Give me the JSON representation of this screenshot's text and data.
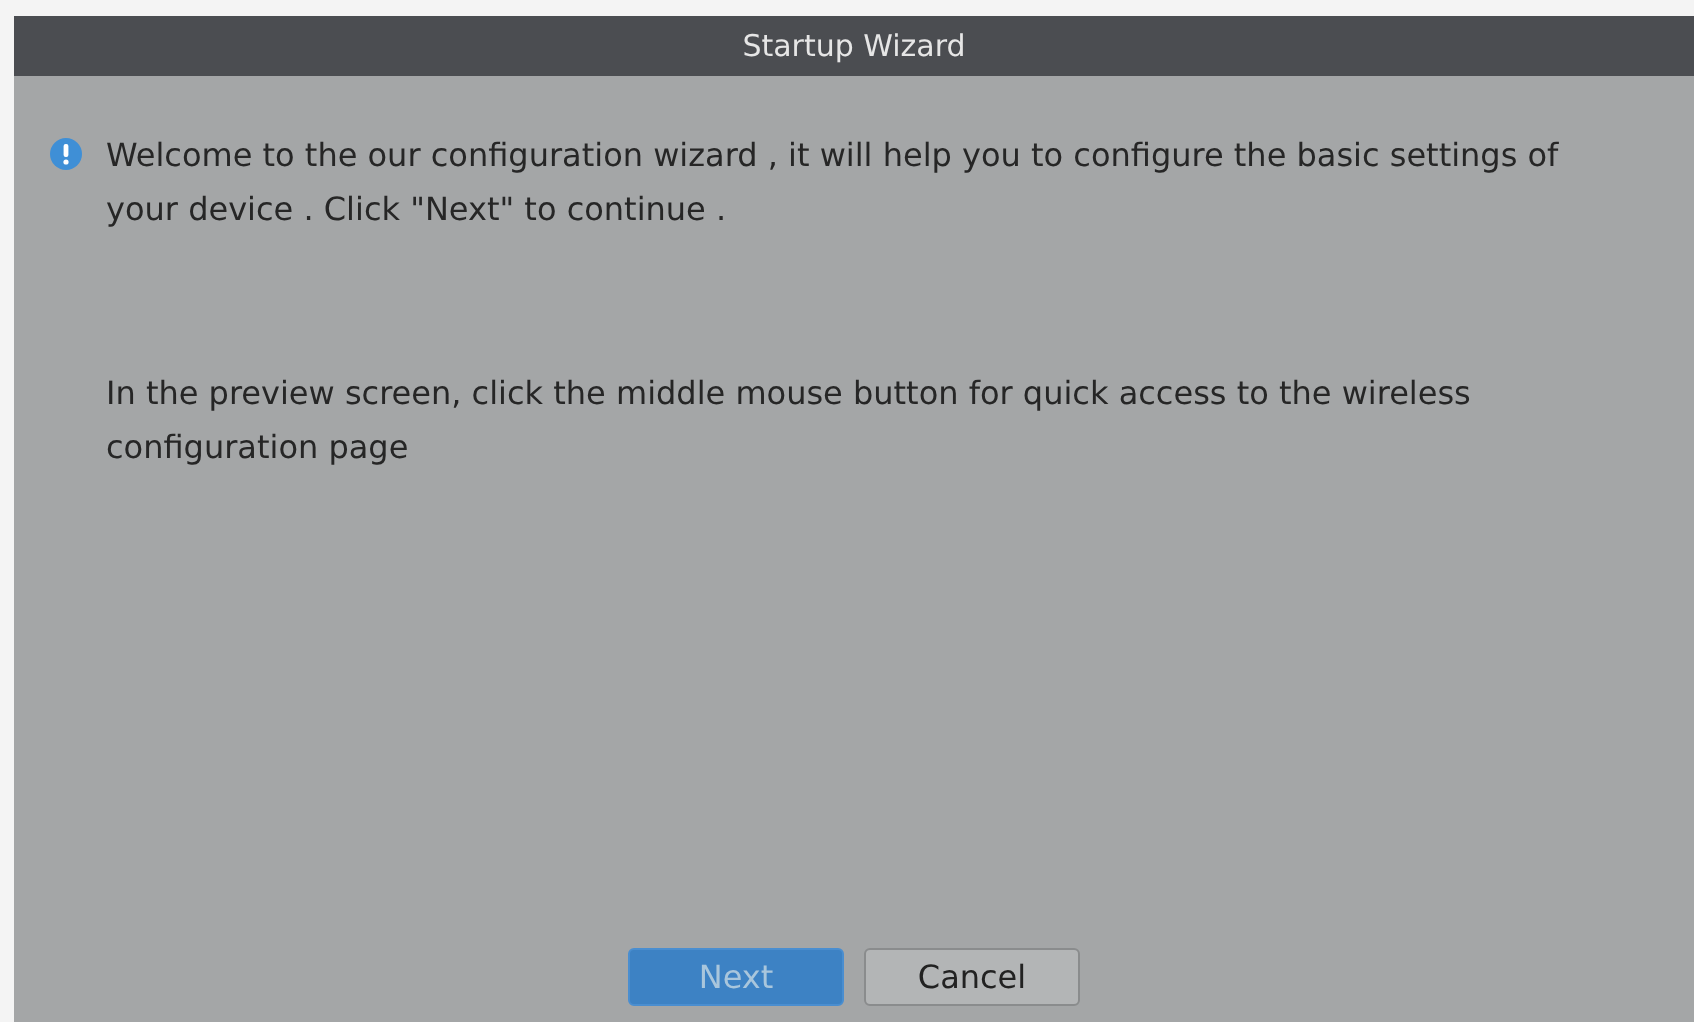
{
  "window": {
    "title": "Startup Wizard"
  },
  "info_message": "Welcome to the our configuration wizard , it will help you to configure the basic settings of your device . Click \"Next\" to continue .",
  "hint": "In the preview screen, click the middle mouse button for quick access to the wireless configuration page",
  "buttons": [
    {
      "label": "Next",
      "kind": "primary"
    },
    {
      "label": "Cancel",
      "kind": "default"
    }
  ]
}
